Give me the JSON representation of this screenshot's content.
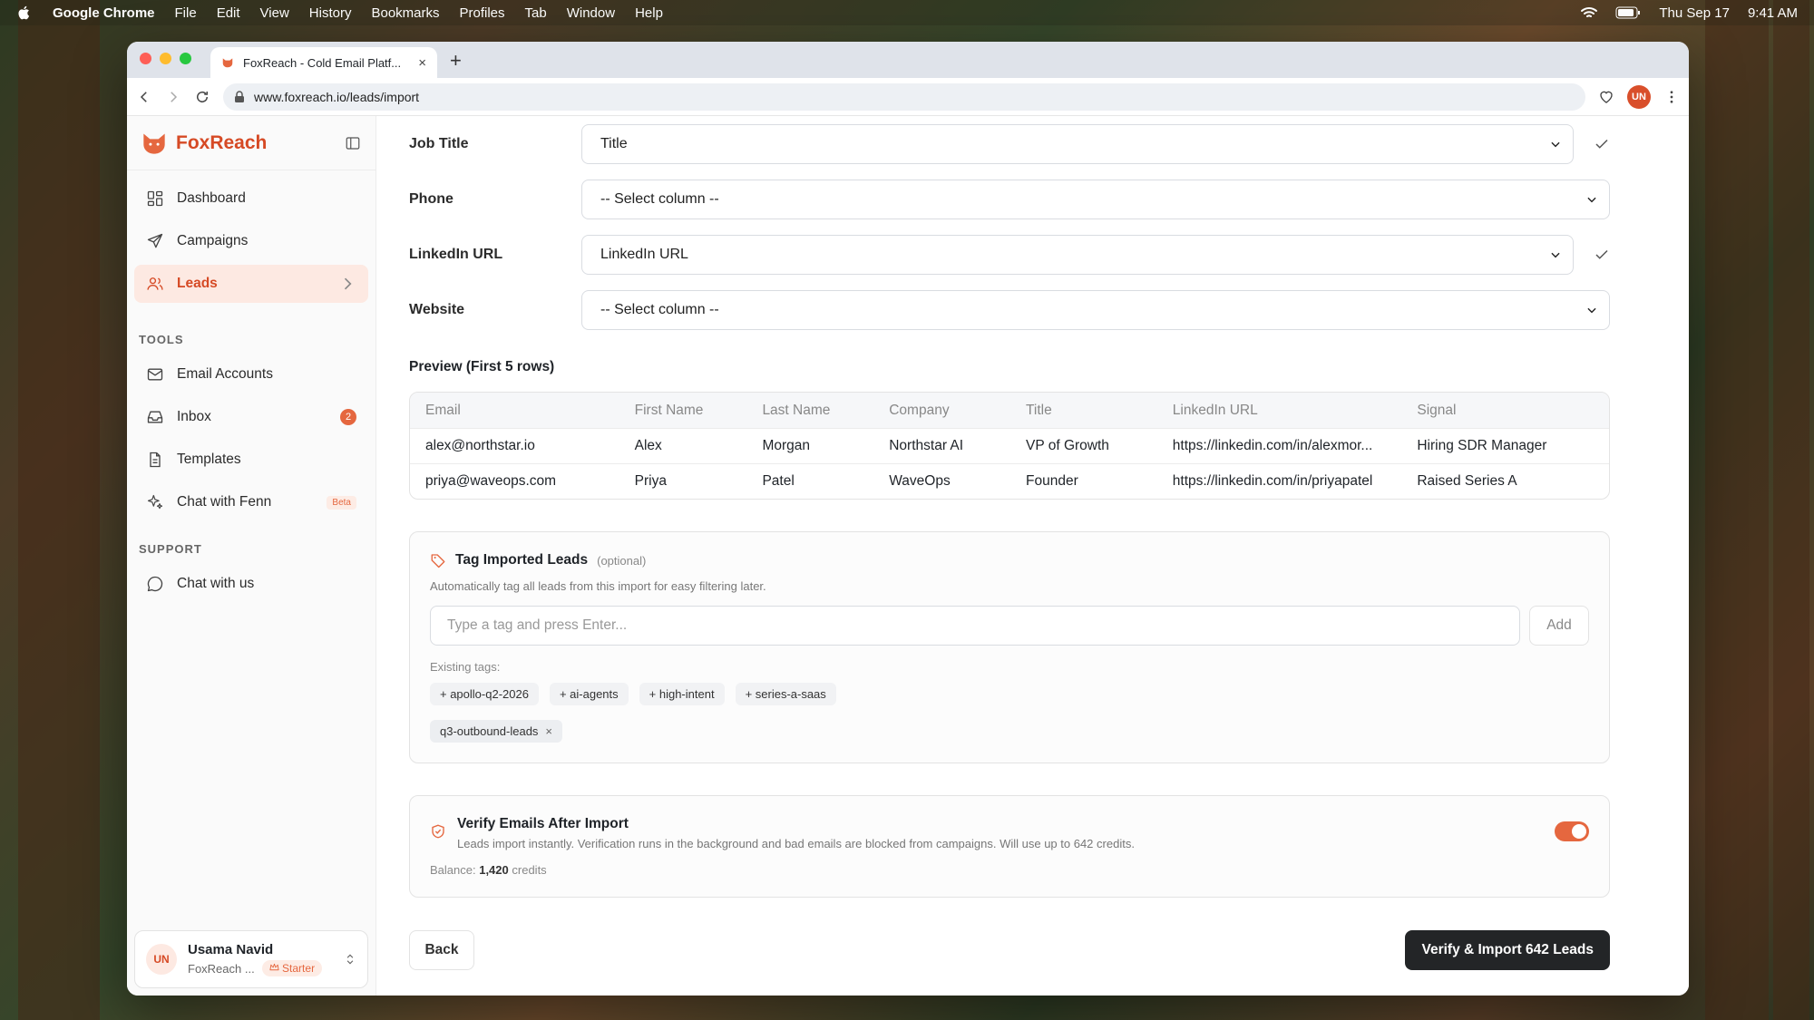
{
  "menubar": {
    "app_name": "Google Chrome",
    "items": [
      "File",
      "Edit",
      "View",
      "History",
      "Bookmarks",
      "Profiles",
      "Tab",
      "Window",
      "Help"
    ],
    "date": "Thu Sep 17",
    "time": "9:41 AM"
  },
  "browser": {
    "tab_title": "FoxReach - Cold Email Platf...",
    "url": "www.foxreach.io/leads/import",
    "profile_initials": "UN"
  },
  "sidebar": {
    "brand": "FoxReach",
    "main_items": [
      {
        "label": "Dashboard"
      },
      {
        "label": "Campaigns"
      },
      {
        "label": "Leads"
      }
    ],
    "tools_label": "TOOLS",
    "tools_items": [
      {
        "label": "Email Accounts"
      },
      {
        "label": "Inbox",
        "badge": "2"
      },
      {
        "label": "Templates"
      },
      {
        "label": "Chat with Fenn",
        "tag": "Beta"
      }
    ],
    "support_label": "SUPPORT",
    "support_items": [
      {
        "label": "Chat with us"
      }
    ],
    "user": {
      "initials": "UN",
      "name": "Usama Navid",
      "org": "FoxReach ...",
      "plan": "Starter"
    }
  },
  "mapping": [
    {
      "label": "Job Title",
      "value": "Title",
      "matched": true
    },
    {
      "label": "Phone",
      "value": "-- Select column --",
      "matched": false
    },
    {
      "label": "LinkedIn URL",
      "value": "LinkedIn URL",
      "matched": true
    },
    {
      "label": "Website",
      "value": "-- Select column --",
      "matched": false
    }
  ],
  "preview": {
    "title": "Preview (First 5 rows)",
    "columns": [
      "Email",
      "First Name",
      "Last Name",
      "Company",
      "Title",
      "LinkedIn URL",
      "Signal"
    ],
    "rows": [
      [
        "alex@northstar.io",
        "Alex",
        "Morgan",
        "Northstar AI",
        "VP of Growth",
        "https://linkedin.com/in/alexmor...",
        "Hiring SDR Manager"
      ],
      [
        "priya@waveops.com",
        "Priya",
        "Patel",
        "WaveOps",
        "Founder",
        "https://linkedin.com/in/priyapatel",
        "Raised Series A"
      ]
    ]
  },
  "tags": {
    "title": "Tag Imported Leads",
    "optional": "(optional)",
    "description": "Automatically tag all leads from this import for easy filtering later.",
    "input_placeholder": "Type a tag and press Enter...",
    "add_label": "Add",
    "existing_label": "Existing tags:",
    "existing": [
      "+ apollo-q2-2026",
      "+ ai-agents",
      "+ high-intent",
      "+ series-a-saas"
    ],
    "selected": [
      "q3-outbound-leads"
    ]
  },
  "verify": {
    "title": "Verify Emails After Import",
    "description": "Leads import instantly. Verification runs in the background and bad emails are blocked from campaigns. Will use up to 642 credits.",
    "enabled": true,
    "balance_label": "Balance:",
    "balance_value": "1,420",
    "balance_unit": "credits"
  },
  "actions": {
    "back_label": "Back",
    "import_label": "Verify & Import 642 Leads"
  },
  "colors": {
    "accent": "#e5673f",
    "brand": "#d64a25",
    "dark_button": "#232527"
  }
}
